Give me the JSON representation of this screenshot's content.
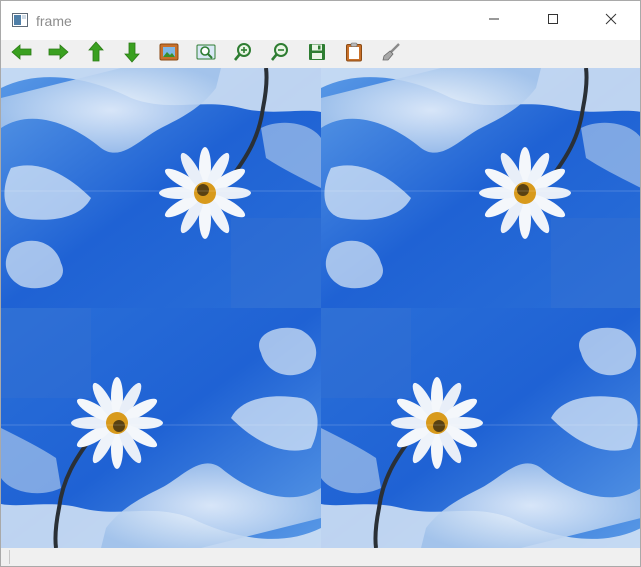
{
  "window": {
    "title": "frame",
    "app_icon": "opencv-window-icon",
    "controls": [
      "minimize-icon",
      "maximize-icon",
      "close-icon"
    ]
  },
  "toolbar": {
    "buttons": [
      {
        "icon": "arrow-left-icon",
        "color": "#3aa020"
      },
      {
        "icon": "arrow-right-icon",
        "color": "#3aa020"
      },
      {
        "icon": "arrow-up-icon",
        "color": "#3aa020"
      },
      {
        "icon": "arrow-down-icon",
        "color": "#3aa020"
      },
      {
        "icon": "image-icon",
        "color": "#c8702a"
      },
      {
        "icon": "zoom-fit-icon",
        "color": "#2e7d32"
      },
      {
        "icon": "zoom-in-icon",
        "color": "#2e7d32"
      },
      {
        "icon": "zoom-out-icon",
        "color": "#2e7d32"
      },
      {
        "icon": "save-icon",
        "color": "#2e7d32"
      },
      {
        "icon": "clipboard-icon",
        "color": "#c8702a"
      },
      {
        "icon": "brush-icon",
        "color": "#8a8a8a"
      }
    ]
  },
  "image": {
    "description_free": true,
    "tiles": [
      "tile-top-left",
      "tile-top-right",
      "tile-bottom-left",
      "tile-bottom-right"
    ],
    "colors": {
      "sky": "#2f6fd6",
      "cloud": "#e9f1fb",
      "petal": "#f4f7fb",
      "center": "#d89a1c",
      "stem": "#2a3036"
    }
  },
  "statusbar": {
    "text": ""
  }
}
